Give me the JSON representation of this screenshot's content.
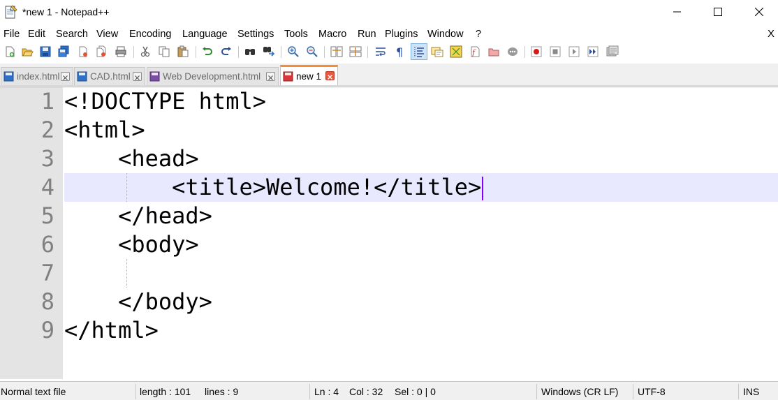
{
  "window": {
    "title": "*new 1 - Notepad++",
    "app_icon": "notepad-icon"
  },
  "menu": {
    "items": [
      "File",
      "Edit",
      "Search",
      "View",
      "Encoding",
      "Language",
      "Settings",
      "Tools",
      "Macro",
      "Run",
      "Plugins",
      "Window",
      "?"
    ],
    "close_doc": "X"
  },
  "toolbar": {
    "icons": [
      "new-file-icon",
      "open-file-icon",
      "save-icon",
      "save-all-icon",
      "close-icon",
      "close-all-icon",
      "print-icon",
      "cut-icon",
      "copy-icon",
      "paste-icon",
      "undo-icon",
      "redo-icon",
      "find-icon",
      "replace-icon",
      "zoom-in-icon",
      "zoom-out-icon",
      "sync-vertical-icon",
      "sync-horizontal-icon",
      "word-wrap-icon",
      "show-all-chars-icon",
      "indent-guide-icon",
      "doc-map-icon",
      "function-list-icon",
      "folder-as-workspace-icon",
      "project-panel-icon",
      "doc-switcher-icon",
      "record-macro-icon",
      "stop-record-icon",
      "play-macro-icon",
      "run-macro-multiple-icon",
      "save-macro-icon"
    ],
    "active": "indent-guide-icon"
  },
  "tabs": [
    {
      "label": "index.html",
      "state": "saved"
    },
    {
      "label": "CAD.html",
      "state": "saved"
    },
    {
      "label": "Web Development.html",
      "state": "saved"
    },
    {
      "label": "new 1",
      "state": "unsaved",
      "active": true
    }
  ],
  "editor": {
    "current_line": 4,
    "lines": [
      {
        "num": "1",
        "text": "<!DOCTYPE html>"
      },
      {
        "num": "2",
        "text": "<html>"
      },
      {
        "num": "3",
        "text": "    <head>"
      },
      {
        "num": "4",
        "text": "        <title>Welcome!</title>"
      },
      {
        "num": "5",
        "text": "    </head>"
      },
      {
        "num": "6",
        "text": "    <body>"
      },
      {
        "num": "7",
        "text": ""
      },
      {
        "num": "8",
        "text": "    </body>"
      },
      {
        "num": "9",
        "text": "</html>"
      }
    ]
  },
  "status": {
    "file_type": "Normal text file",
    "length": "length : 101",
    "lines": "lines : 9",
    "ln": "Ln : 4",
    "col": "Col : 32",
    "sel": "Sel : 0 | 0",
    "eol": "Windows (CR LF)",
    "encoding": "UTF-8",
    "mode": "INS"
  }
}
